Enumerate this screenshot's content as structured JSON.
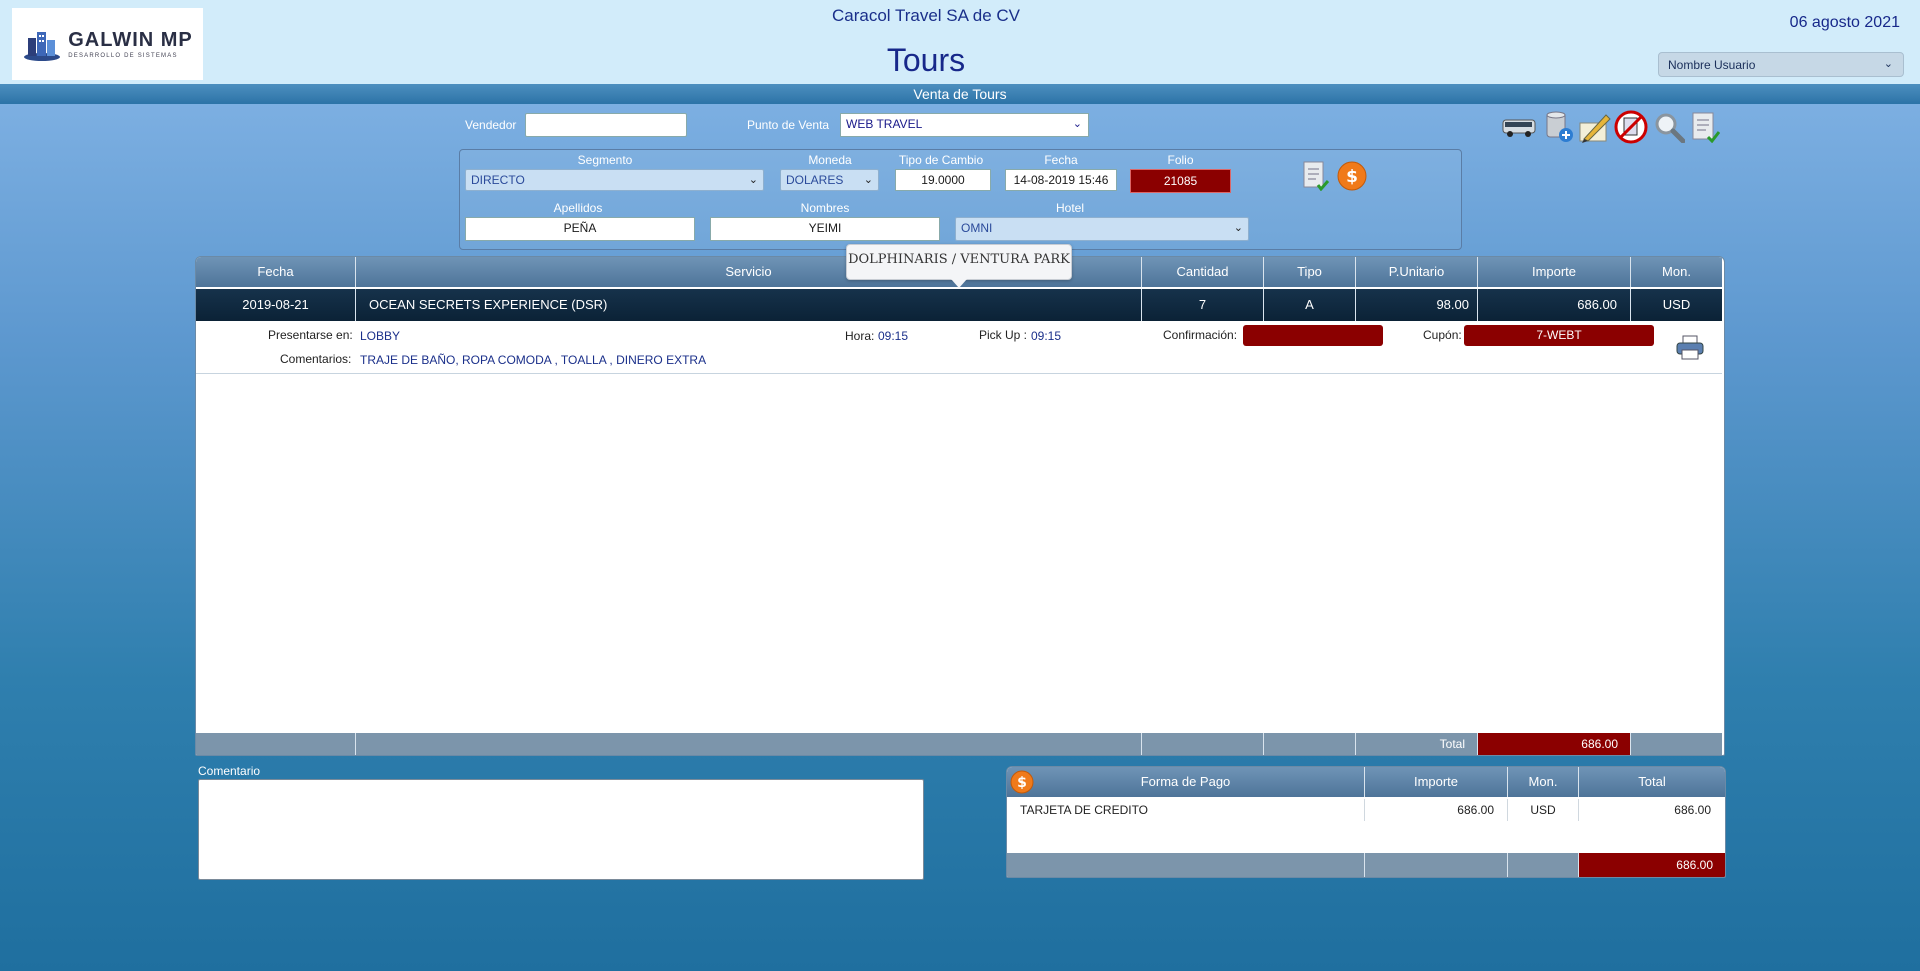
{
  "header": {
    "logo": {
      "name": "GALWIN MP",
      "tagline": "DESARROLLO DE SISTEMAS"
    },
    "company": "Caracol Travel SA de CV",
    "title": "Tours",
    "date": "06 agosto 2021",
    "user_select": "Nombre Usuario",
    "subtitle": "Venta de Tours"
  },
  "form": {
    "vendedor_label": "Vendedor",
    "vendedor_value": "",
    "punto_venta_label": "Punto de Venta",
    "punto_venta_value": "WEB TRAVEL",
    "segmento_label": "Segmento",
    "segmento_value": "DIRECTO",
    "moneda_label": "Moneda",
    "moneda_value": "DOLARES",
    "tipo_cambio_label": "Tipo de Cambio",
    "tipo_cambio_value": "19.0000",
    "fecha_label": "Fecha",
    "fecha_value": "14-08-2019 15:46",
    "folio_label": "Folio",
    "folio_value": "21085",
    "apellidos_label": "Apellidos",
    "apellidos_value": "PEÑA",
    "nombres_label": "Nombres",
    "nombres_value": "YEIMI",
    "hotel_label": "Hotel",
    "hotel_value": "OMNI"
  },
  "toolbar": {
    "icons": [
      "bus-icon",
      "add-database-icon",
      "edit-note-icon",
      "cancel-document-icon",
      "search-icon",
      "approve-document-icon"
    ]
  },
  "grid": {
    "columns": [
      "Fecha",
      "Servicio",
      "Cantidad",
      "Tipo",
      "P.Unitario",
      "Importe",
      "Mon."
    ],
    "row": {
      "fecha": "2019-08-21",
      "servicio": "OCEAN SECRETS EXPERIENCE (DSR)",
      "cantidad": "7",
      "tipo": "A",
      "p_unitario": "98.00",
      "importe": "686.00",
      "mon": "USD"
    },
    "detail": {
      "presentarse_label": "Presentarse en:",
      "presentarse_value": "LOBBY",
      "hora_label": "Hora:",
      "hora_value": "09:15",
      "pickup_label": "Pick Up :",
      "pickup_value": "09:15",
      "confirmacion_label": "Confirmación:",
      "confirmacion_value": "",
      "cupon_label": "Cupón:",
      "cupon_value": "7-WEBT",
      "comentarios_label": "Comentarios:",
      "comentarios_value": "TRAJE DE BAÑO, ROPA COMODA , TOALLA , DINERO EXTRA"
    },
    "tooltip": "DOLPHINARIS / VENTURA PARK",
    "total_label": "Total",
    "total_value": "686.00"
  },
  "comment": {
    "label": "Comentario",
    "value": ""
  },
  "payment": {
    "columns": [
      "Forma de Pago",
      "Importe",
      "Mon.",
      "Total"
    ],
    "rows": [
      {
        "forma": "TARJETA DE CREDITO",
        "importe": "686.00",
        "mon": "USD",
        "total": "686.00"
      }
    ],
    "total": "686.00"
  },
  "colors": {
    "accent_red": "#8b0000",
    "header_bg": "#d2ecfa",
    "title_blue": "#17288a",
    "row_dark": "#0b2236",
    "coin_orange": "#f07a1a"
  }
}
